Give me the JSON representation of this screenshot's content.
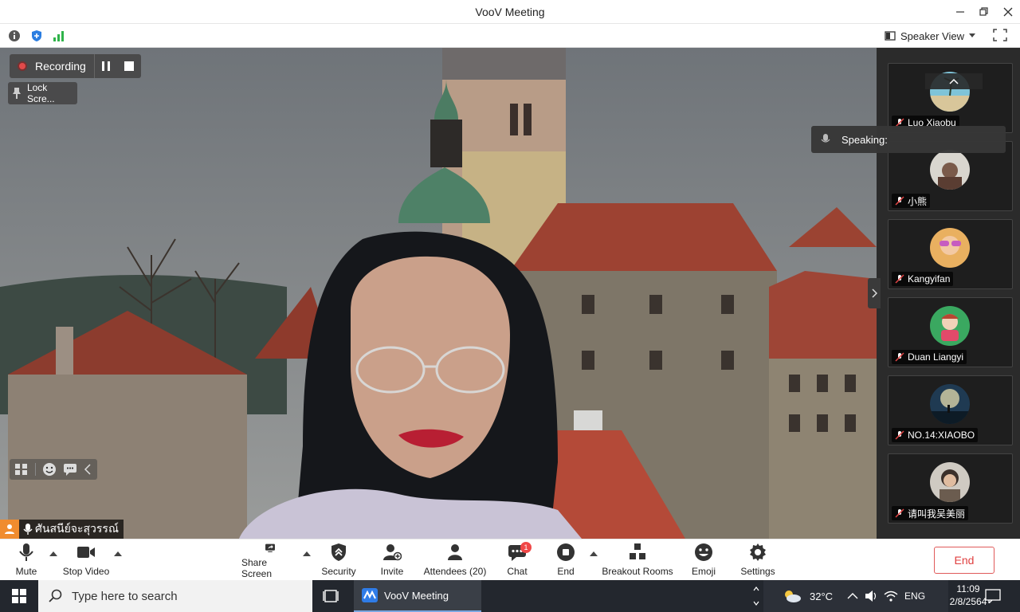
{
  "window": {
    "title": "VooV Meeting",
    "controls": {
      "minimize": "minimize-icon",
      "restore": "restore-icon",
      "close": "close-icon"
    }
  },
  "infobar": {
    "view_label": "Speaker View"
  },
  "recording": {
    "label": "Recording"
  },
  "lock_screen": {
    "label": "Lock Scre..."
  },
  "main_speaker": {
    "name": "ศันสนีย์จะสุวรรณ์"
  },
  "speaking": {
    "label": "Speaking:"
  },
  "participants": [
    {
      "name": "Luo Xiaobu"
    },
    {
      "name": "小熊"
    },
    {
      "name": "Kangyifan"
    },
    {
      "name": "Duan Liangyi"
    },
    {
      "name": "NO.14:XIAOBO"
    },
    {
      "name": "请叫我吴美丽"
    }
  ],
  "toolbar": {
    "mute": "Mute",
    "stop_video": "Stop Video",
    "share_screen": "Share Screen",
    "security": "Security",
    "invite": "Invite",
    "attendees": "Attendees (20)",
    "chat": "Chat",
    "chat_badge": "1",
    "end_rec": "End",
    "breakout": "Breakout Rooms",
    "emoji": "Emoji",
    "settings": "Settings",
    "end_meeting": "End"
  },
  "taskbar": {
    "search_placeholder": "Type here to search",
    "app_label": "VooV Meeting",
    "temperature": "32°C",
    "language": "ENG",
    "time": "11:09",
    "date": "2/8/2564"
  },
  "colors": {
    "end_red": "#e04040",
    "taskbar": "#23272e",
    "panel": "#2b2b2b",
    "badge": "#f04848"
  }
}
